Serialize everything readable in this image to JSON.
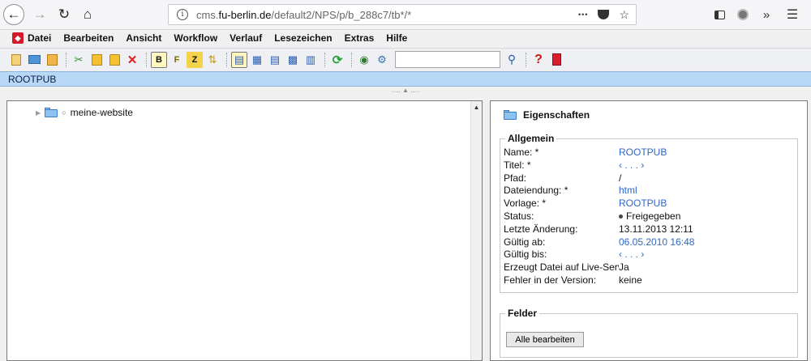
{
  "browser": {
    "url_prefix": "cms.",
    "url_domain": "fu-berlin.de",
    "url_path": "/default2/NPS/p/b_288c7/tb*/*",
    "more_glyph": "•••"
  },
  "menu": {
    "items": [
      "Datei",
      "Bearbeiten",
      "Ansicht",
      "Workflow",
      "Verlauf",
      "Lesezeichen",
      "Extras",
      "Hilfe"
    ]
  },
  "toolbar": {
    "icons": [
      "new-file-icon",
      "new-folder-icon",
      "upload-icon",
      "cut-icon",
      "copy-icon",
      "paste-icon",
      "delete-icon",
      "sort-b-icon",
      "sort-f-icon",
      "sort-z-icon",
      "sort-custom-icon",
      "view-tree-icon",
      "view-columns-icon",
      "view-list-icon",
      "view-grid-icon",
      "view-detail-icon",
      "refresh-icon",
      "preview-icon",
      "settings-icon",
      "search-icon",
      "help-icon",
      "exit-icon"
    ],
    "search_value": ""
  },
  "path": "ROOTPUB",
  "tree": {
    "items": [
      {
        "label": "meine-website"
      }
    ]
  },
  "props": {
    "title": "Eigenschaften",
    "allgemein_legend": "Allgemein",
    "rows": [
      {
        "label": "Name: *",
        "value": "ROOTPUB",
        "kind": "link"
      },
      {
        "label": "Titel: *",
        "value": "‹ . . . ›",
        "kind": "link"
      },
      {
        "label": "Pfad:",
        "value": "/",
        "kind": "plain"
      },
      {
        "label": "Dateiendung: *",
        "value": "html",
        "kind": "link"
      },
      {
        "label": "Vorlage: *",
        "value": "ROOTPUB",
        "kind": "link"
      },
      {
        "label": "Status:",
        "value": "Freigegeben",
        "kind": "status"
      },
      {
        "label": "Letzte Änderung:",
        "value": "13.11.2013 12:11",
        "kind": "plain"
      },
      {
        "label": "Gültig ab:",
        "value": "06.05.2010 16:48",
        "kind": "link"
      },
      {
        "label": "Gültig bis:",
        "value": "‹ . . . ›",
        "kind": "link"
      },
      {
        "label": "Erzeugt Datei auf Live-Server:",
        "value": "Ja",
        "kind": "plain"
      },
      {
        "label": "Fehler in der Version:",
        "value": "keine",
        "kind": "plain"
      }
    ],
    "felder_legend": "Felder",
    "edit_all_label": "Alle bearbeiten"
  },
  "colors": {
    "link": "#2e66c8",
    "pathbar": "#b9d8f6",
    "logo": "#d21a2a"
  }
}
